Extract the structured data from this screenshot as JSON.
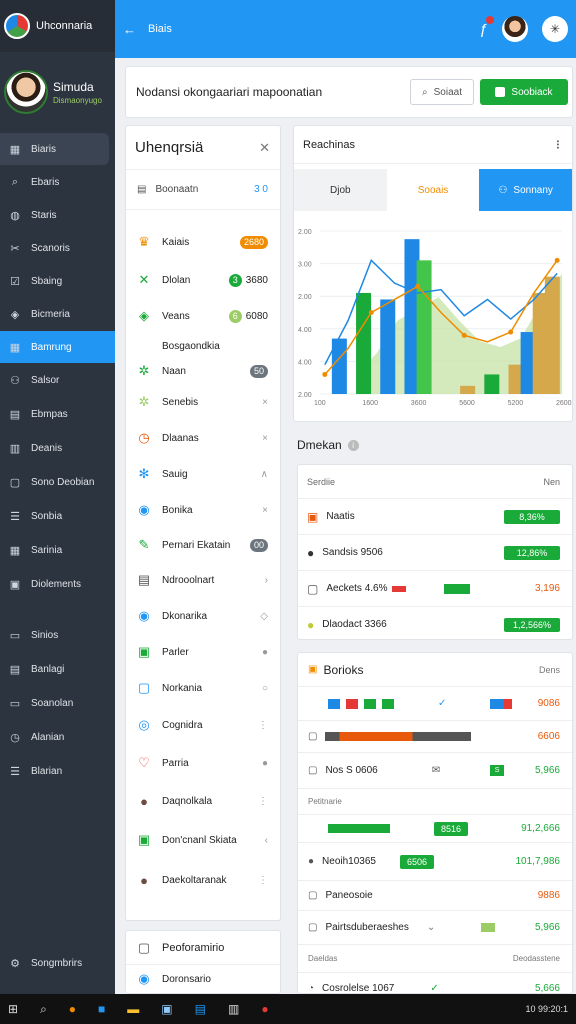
{
  "app": {
    "brand": "Uhconnaria",
    "header_title": "Biais"
  },
  "profile": {
    "name": "Simuda",
    "subtitle": "Dismaonyugo"
  },
  "sidebar": {
    "items": [
      {
        "label": "Biaris",
        "icon": "building-icon"
      },
      {
        "label": "Ebaris",
        "icon": "search-icon"
      },
      {
        "label": "Staris",
        "icon": "globe-icon"
      },
      {
        "label": "Scanoris",
        "icon": "tools-icon"
      },
      {
        "label": "Sbaing",
        "icon": "checkbox-icon"
      },
      {
        "label": "Bicmeria",
        "icon": "shield-icon"
      },
      {
        "label": "Bamrung",
        "icon": "calendar-icon"
      },
      {
        "label": "Salsor",
        "icon": "people-icon"
      },
      {
        "label": "Ebmpas",
        "icon": "table-icon"
      },
      {
        "label": "Deanis",
        "icon": "document-icon"
      },
      {
        "label": "Sono Deobian",
        "icon": "window-icon"
      },
      {
        "label": "Sonbia",
        "icon": "list-icon"
      },
      {
        "label": "Sarinia",
        "icon": "calendar-grid-icon"
      },
      {
        "label": "Diolements",
        "icon": "panel-icon"
      },
      {
        "label": "Sinios",
        "icon": "tag-icon"
      },
      {
        "label": "Banlagi",
        "icon": "layout-icon"
      },
      {
        "label": "Soanolan",
        "icon": "monitor-icon"
      },
      {
        "label": "Alanian",
        "icon": "clock-icon"
      },
      {
        "label": "Blarian",
        "icon": "list-icon"
      }
    ],
    "footer": {
      "label": "Songmbrirs",
      "icon": "gear-icon"
    }
  },
  "banner": {
    "text": "Nodansi okongaariari mapoonatian",
    "search_label": "Soiaat",
    "action_label": "Soobiack"
  },
  "list_panel": {
    "title": "Uhenqrsiä",
    "filter_label": "Boonaatn",
    "filter_value": "3 0",
    "items": [
      {
        "label": "Kaiais",
        "pill": "2680",
        "pill_color": "orange",
        "icon": "crown-icon"
      },
      {
        "label": "Dlolan",
        "pill": "3",
        "value": "3680",
        "pill_color": "green",
        "icon": "cross-icon"
      },
      {
        "label": "Veans",
        "pill": "6",
        "value": "6080",
        "pill_color": "ygreen",
        "icon": "shield-icon"
      },
      {
        "label": "Bosgaondkia",
        "icon": "none"
      },
      {
        "label": "Naan",
        "pill": "50",
        "pill_color": "gray",
        "icon": "sparkle-icon"
      },
      {
        "label": "Senebis",
        "end": "×",
        "icon": "gear-icon"
      },
      {
        "label": "Dlaanas",
        "end": "×",
        "icon": "clock-icon"
      },
      {
        "label": "Sauig",
        "end": "∧",
        "icon": "cog-icon"
      },
      {
        "label": "Bonika",
        "end": "×",
        "icon": "dot-icon"
      },
      {
        "label": "Pernari Ekatain",
        "pill": "00",
        "pill_color": "gray",
        "icon": "pen-icon"
      },
      {
        "label": "Ndrooolnart",
        "end": "›",
        "icon": "doc-icon"
      },
      {
        "label": "Dkonarika",
        "end": "◇",
        "icon": "circle-icon"
      },
      {
        "label": "Parler",
        "end": "●",
        "icon": "square-icon"
      },
      {
        "label": "Norkania",
        "end": "○",
        "icon": "edit-icon"
      },
      {
        "label": "Cognidra",
        "end": "⋮",
        "icon": "ring-icon"
      },
      {
        "label": "Parria",
        "end": "●",
        "icon": "heart-icon"
      },
      {
        "label": "Daqnolkala",
        "end": "⋮",
        "icon": "avatar-icon"
      },
      {
        "label": "Don'cnanl Skiata",
        "end": "‹",
        "icon": "check-square-icon"
      },
      {
        "label": "Daekoltaranak",
        "end": "⋮",
        "icon": "avatar-icon"
      }
    ],
    "bottom": {
      "title": "Peoforamirio",
      "item": "Doronsario"
    }
  },
  "tabs_panel": {
    "title": "Reachinas",
    "tabs": [
      "Djob",
      "Sooais",
      "Sonnany"
    ]
  },
  "chart_data": {
    "type": "bar",
    "categories": [
      "100",
      "1600",
      "3600",
      "5600",
      "5200",
      "2600"
    ],
    "ylabels": [
      "2.00",
      "3.00",
      "2.00",
      "4.00",
      "4.00",
      "2.00"
    ],
    "bars": [
      {
        "x": 0.08,
        "v": 0.34,
        "c": "#1e88e5"
      },
      {
        "x": 0.18,
        "v": 0.62,
        "c": "#1aaa3a"
      },
      {
        "x": 0.28,
        "v": 0.58,
        "c": "#1e88e5"
      },
      {
        "x": 0.38,
        "v": 0.95,
        "c": "#1e88e5"
      },
      {
        "x": 0.43,
        "v": 0.82,
        "c": "#43c44b"
      },
      {
        "x": 0.61,
        "v": 0.05,
        "c": "#d4a84b"
      },
      {
        "x": 0.71,
        "v": 0.12,
        "c": "#1aaa3a"
      },
      {
        "x": 0.81,
        "v": 0.18,
        "c": "#d4a84b"
      },
      {
        "x": 0.86,
        "v": 0.38,
        "c": "#1e88e5"
      },
      {
        "x": 0.91,
        "v": 0.62,
        "c": "#d4a84b"
      },
      {
        "x": 0.96,
        "v": 0.72,
        "c": "#d4a84b"
      }
    ],
    "line_blue": [
      0.18,
      0.45,
      0.82,
      0.68,
      0.62,
      0.64,
      0.48,
      0.58,
      0.46,
      0.58,
      0.74
    ],
    "line_orange": [
      0.12,
      0.28,
      0.5,
      0.58,
      0.66,
      0.5,
      0.36,
      0.32,
      0.38,
      0.62,
      0.82
    ]
  },
  "table_section": {
    "title": "Dmekan",
    "header_left": "Serdiie",
    "header_right": "Nen",
    "rows": [
      {
        "label": "Naatis",
        "badge": "8,36%",
        "icon": "red-square-icon"
      },
      {
        "label": "Sandsis 9506",
        "badge": "12,86%",
        "icon": "avatar-icon"
      },
      {
        "label": "Aeckets 4.6%",
        "value": "3,196",
        "icon": "checkbox-icon"
      },
      {
        "label": "Dlaodact 3366",
        "badge": "1,2,566%",
        "icon": "yellow-circle-icon"
      }
    ]
  },
  "books_section": {
    "title": "Borioks",
    "right": "Dens",
    "rows": [
      {
        "value": "9086"
      },
      {
        "value": "6606"
      },
      {
        "label": "Nos S 0606",
        "value": "5,966",
        "tag": "S"
      },
      {
        "label": "Petitnarie"
      },
      {
        "badge": "8516",
        "value": "91,2,666"
      },
      {
        "label": "Neoih10365",
        "badge": "6506",
        "value": "101,7,986"
      },
      {
        "label": "Paneosoie",
        "value": "9886"
      },
      {
        "label": "Pairtsduberaeshes",
        "value": "5,966"
      }
    ],
    "footer_left": "Daeldas",
    "footer_right": "Deodasstene",
    "last": {
      "label": "Cosrolelse 1067",
      "value": "5,666"
    }
  },
  "taskbar": {
    "time": "10 99:20:1"
  }
}
